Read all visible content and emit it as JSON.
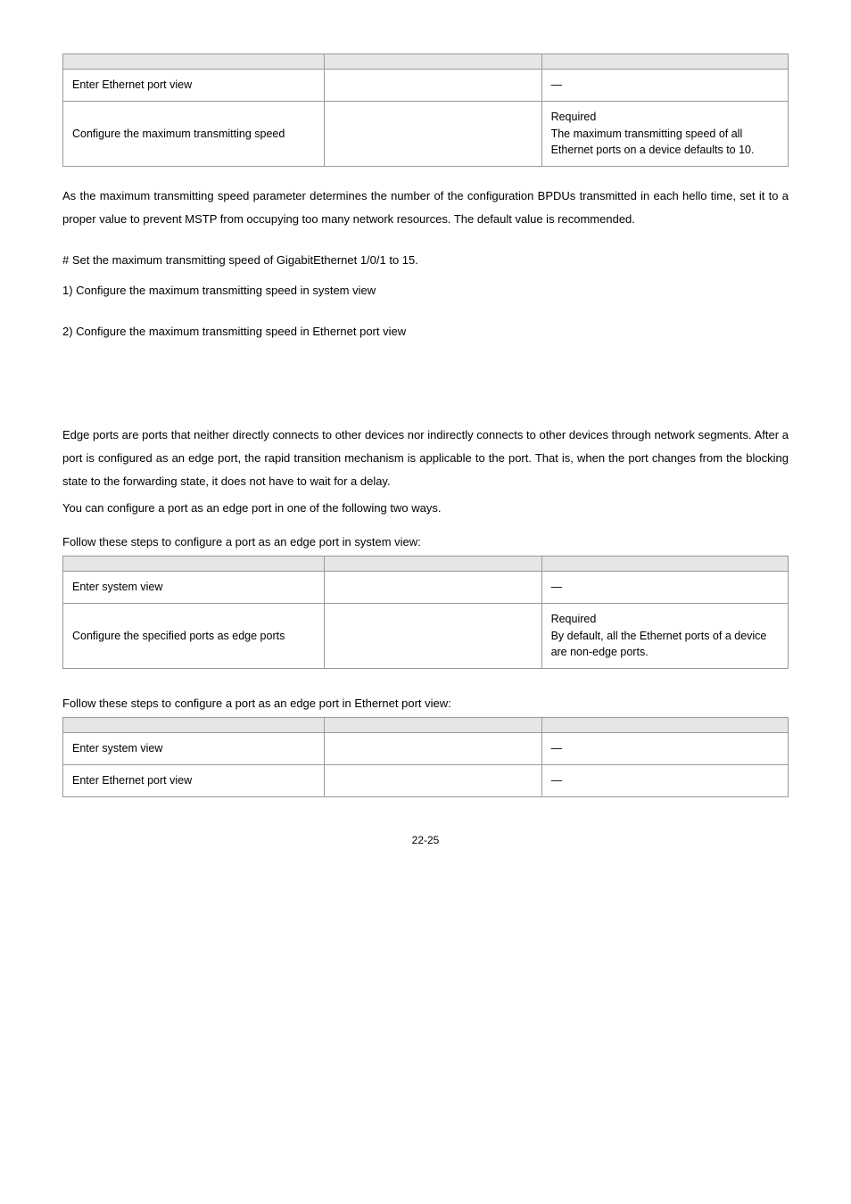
{
  "table1": {
    "r1_col1": " Enter Ethernet port view",
    "r1_col3": "—",
    "r2_col1": " Configure the maximum transmitting speed",
    "r2_col3_a": "Required",
    "r2_col3_b": " The maximum transmitting speed of all Ethernet ports on a device defaults to 10."
  },
  "para1": "As the maximum transmitting speed parameter determines the number of the configuration BPDUs transmitted in each hello time, set it to a proper value to prevent MSTP from occupying too many network resources. The default value is recommended.",
  "example_line": "# Set the maximum transmitting speed of GigabitEthernet 1/0/1 to 15.",
  "item1": "1)   Configure the maximum transmitting speed in system view",
  "item2": "2)   Configure the maximum transmitting speed in Ethernet port view",
  "para2": "Edge ports are ports that neither directly connects to other devices nor indirectly connects to other devices through network segments. After a port is configured as an edge port, the rapid transition mechanism is applicable to the port. That is, when the port changes from the blocking state to the forwarding state, it does not have to wait for a delay.",
  "para2b": "You can configure a port as an edge port in one of the following two ways.",
  "caption2": "Follow these steps to configure a port as an edge port in system view:",
  "table2": {
    "r1_col1": " Enter system view",
    "r1_col3": "—",
    "r2_col1": " Configure the specified ports as edge ports",
    "r2_col3_a": "Required",
    "r2_col3_b": " By default, all the Ethernet ports of a device are non-edge ports."
  },
  "caption3": "Follow these steps to configure a port as an edge port in Ethernet port view:",
  "table3": {
    "r1_col1": " Enter system view",
    "r1_col3": "—",
    "r2_col1": " Enter Ethernet port view",
    "r2_col3": "—"
  },
  "page_number": "22-25"
}
